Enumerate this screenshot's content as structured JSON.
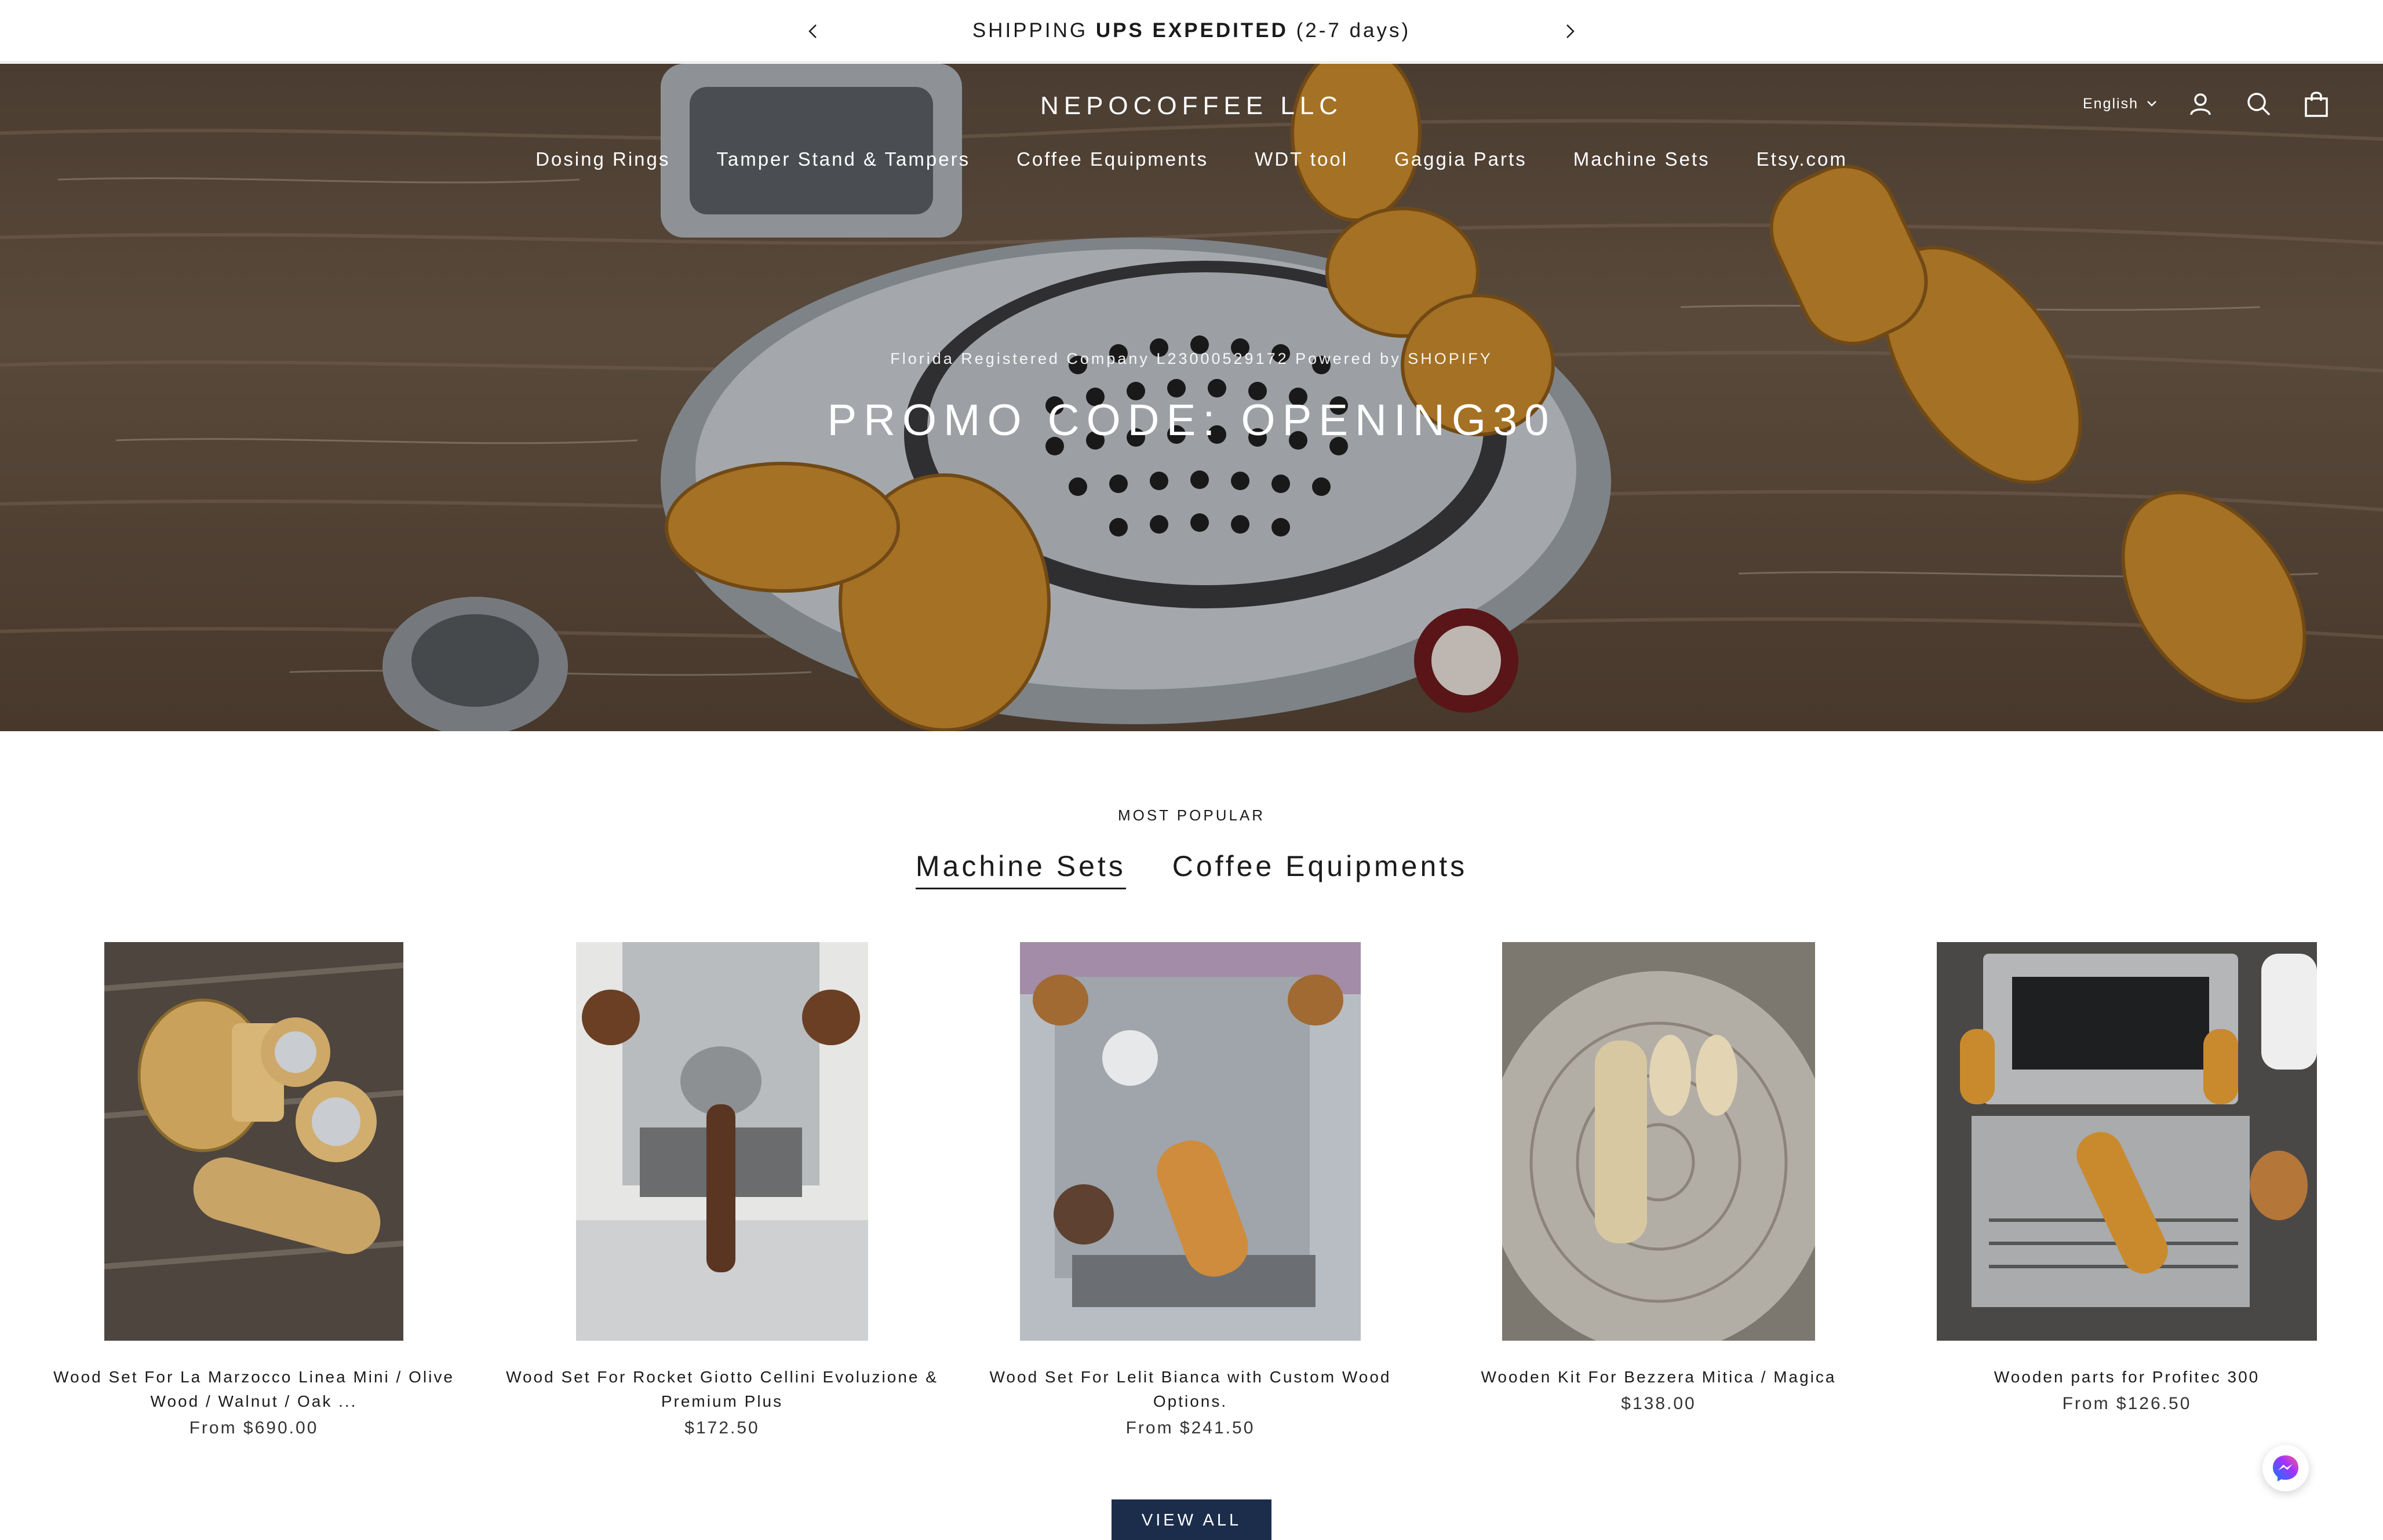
{
  "announcement": {
    "prefix": "SHIPPING ",
    "bold": "UPS EXPEDITED",
    "suffix": " (2-7 days)"
  },
  "header": {
    "logo": "NEPOCOFFEE LLC",
    "language": "English",
    "nav": [
      "Dosing Rings",
      "Tamper Stand & Tampers",
      "Coffee Equipments",
      "WDT tool",
      "Gaggia Parts",
      "Machine Sets",
      "Etsy.com"
    ]
  },
  "hero": {
    "subtitle": "Florida Registered Company L23000529172 Powered by SHOPIFY",
    "title": "PROMO CODE: OPENING30"
  },
  "popular": {
    "eyebrow": "MOST POPULAR",
    "tabs": [
      "Machine Sets",
      "Coffee Equipments"
    ],
    "active_tab": "Machine Sets",
    "products": [
      {
        "title": "Wood Set For La Marzocco Linea Mini / Olive Wood / Walnut / Oak ...",
        "price": "From $690.00"
      },
      {
        "title": "Wood Set For Rocket Giotto Cellini Evoluzione & Premium Plus",
        "price": "$172.50"
      },
      {
        "title": "Wood Set For Lelit Bianca with Custom Wood Options.",
        "price": "From $241.50"
      },
      {
        "title": "Wooden Kit For Bezzera Mitica / Magica",
        "price": "$138.00"
      },
      {
        "title": "Wooden parts for Profitec 300",
        "price": "From $126.50"
      }
    ],
    "view_all": "VIEW ALL"
  },
  "icons": {
    "prev": "chevron-left-icon",
    "next": "chevron-right-icon",
    "account": "user-icon",
    "search": "search-icon",
    "cart": "bag-icon",
    "chat": "messenger-icon"
  },
  "colors": {
    "button_bg": "#1b2d4b",
    "text": "#1c1b1b",
    "wood": "#c98a2e"
  }
}
